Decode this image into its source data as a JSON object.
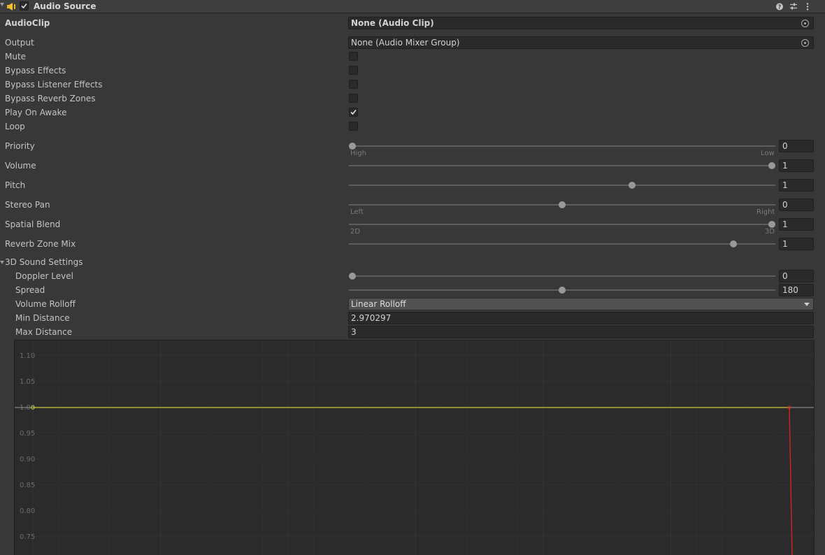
{
  "component": {
    "title": "Audio Source",
    "enabled": true,
    "icons": [
      "help-icon",
      "preset-icon",
      "menu-icon"
    ]
  },
  "fields": {
    "audioclip_label": "AudioClip",
    "audioclip_value": "None (Audio Clip)",
    "output_label": "Output",
    "output_value": "None (Audio Mixer Group)"
  },
  "toggles": [
    {
      "label": "Mute",
      "checked": false
    },
    {
      "label": "Bypass Effects",
      "checked": false
    },
    {
      "label": "Bypass Listener Effects",
      "checked": false
    },
    {
      "label": "Bypass Reverb Zones",
      "checked": false
    },
    {
      "label": "Play On Awake",
      "checked": true
    },
    {
      "label": "Loop",
      "checked": false
    }
  ],
  "sliders": {
    "priority": {
      "label": "Priority",
      "value": "0",
      "fraction": 0,
      "left_tick": "High",
      "right_tick": "Low"
    },
    "volume": {
      "label": "Volume",
      "value": "1",
      "fraction": 1
    },
    "pitch": {
      "label": "Pitch",
      "value": "1",
      "fraction": 0.667
    },
    "stereo_pan": {
      "label": "Stereo Pan",
      "value": "0",
      "fraction": 0.5,
      "left_tick": "Left",
      "right_tick": "Right"
    },
    "spatial_blend": {
      "label": "Spatial Blend",
      "value": "1",
      "fraction": 1,
      "left_tick": "2D",
      "right_tick": "3D"
    },
    "reverb_zone_mix": {
      "label": "Reverb Zone Mix",
      "value": "1",
      "fraction": 0.909
    }
  },
  "sound3d": {
    "section_label": "3D Sound Settings",
    "doppler": {
      "label": "Doppler Level",
      "value": "0",
      "fraction": 0
    },
    "spread": {
      "label": "Spread",
      "value": "180",
      "fraction": 0.5
    },
    "rolloff_label": "Volume Rolloff",
    "rolloff_value": "Linear Rolloff",
    "min_distance_label": "Min Distance",
    "min_distance_value": "2.970297",
    "max_distance_label": "Max Distance",
    "max_distance_value": "3"
  },
  "graph": {
    "y_labels": [
      "1.10",
      "1.05",
      "1.00",
      "0.95",
      "0.90",
      "0.85",
      "0.80",
      "0.75"
    ],
    "volume_curve_color": "#c8c83c",
    "max_distance_marker_color": "#d0241c"
  }
}
